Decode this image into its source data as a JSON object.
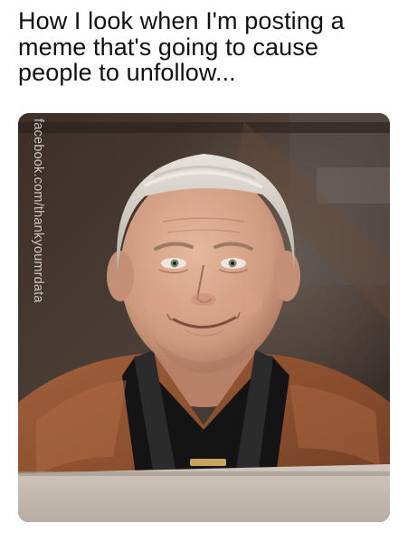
{
  "caption": {
    "text": "How I look when I'm posting a\nmeme that's going to cause\npeople to unfollow..."
  },
  "photo": {
    "subject": "smiling man with slicked-back white hair in a brown jacket",
    "watermark": "facebook.com/thankyoumrdata"
  },
  "colors": {
    "background": "#ffffff",
    "caption_text": "#111111",
    "jacket": "#8a4e2e",
    "skin": "#d9a98e"
  }
}
